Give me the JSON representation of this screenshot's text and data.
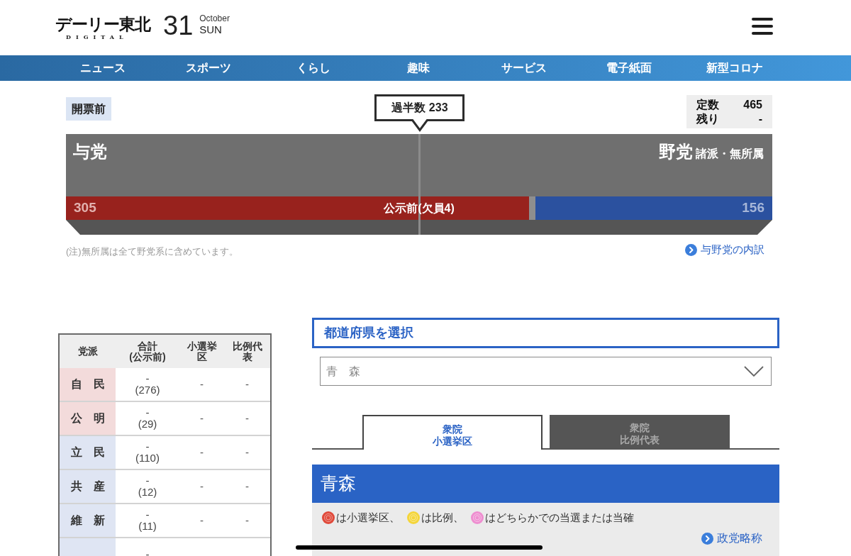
{
  "header": {
    "logo": "デーリー東北",
    "logo_subtitle": "DIGITAL",
    "day": "31",
    "month": "October",
    "weekday": "SUN"
  },
  "nav": [
    "ニュース",
    "スポーツ",
    "くらし",
    "趣味",
    "サービス",
    "電子紙面",
    "新型コロナ"
  ],
  "seat_summary": {
    "status": "開票前",
    "majority": {
      "label": "過半数 233",
      "level": 0.501
    },
    "totals": [
      {
        "label": "定数",
        "value": "465"
      },
      {
        "label": "残り",
        "value": "-"
      }
    ],
    "ruling": {
      "label": "与党",
      "seats": "305",
      "level": 0.656
    },
    "opposition": {
      "label": "野党",
      "sublabel": "諸派・無所属",
      "seats": "156",
      "level": 0.335
    },
    "vacancy_label": "公示前(欠員4)",
    "note": "(注)無所属は全て野党系に含めています。",
    "link": "与野党の内訳"
  },
  "party_table": {
    "columns": [
      {
        "lines": [
          "党派"
        ]
      },
      {
        "lines": [
          "合計",
          "(公示前)"
        ]
      },
      {
        "lines": [
          "小選挙区"
        ]
      },
      {
        "lines": [
          "比例代表"
        ]
      }
    ],
    "rows": [
      {
        "party": "自　民",
        "color": "#f3dbdb",
        "total": "-",
        "pre_election": "(276)",
        "district": "-",
        "proportional": "-"
      },
      {
        "party": "公　明",
        "color": "#f3dbdb",
        "total": "-",
        "pre_election": "(29)",
        "district": "-",
        "proportional": "-"
      },
      {
        "party": "立　民",
        "color": "#dfe5f3",
        "total": "-",
        "pre_election": "(110)",
        "district": "-",
        "proportional": "-"
      },
      {
        "party": "共　産",
        "color": "#dfe5f3",
        "total": "-",
        "pre_election": "(12)",
        "district": "-",
        "proportional": "-"
      },
      {
        "party": "維　新",
        "color": "#dfe5f3",
        "total": "-",
        "pre_election": "(11)",
        "district": "-",
        "proportional": "-"
      },
      {
        "color": "#dfe5f3",
        "total": "-"
      }
    ]
  },
  "prefecture": {
    "heading": "都道府県を選択",
    "value": "青　森"
  },
  "tabs": [
    {
      "lines": [
        "衆院",
        "小選挙区"
      ],
      "selected": true
    },
    {
      "lines": [
        "衆院",
        "比例代表"
      ],
      "selected": false
    }
  ],
  "results": {
    "title": "青森",
    "legend": [
      {
        "color": "#e04a3b",
        "text": "は小選挙区、"
      },
      {
        "color": "#f4d53a",
        "text": "は比例、"
      },
      {
        "color": "#ee8ed0",
        "text": "はどちらかでの当選または当確"
      }
    ],
    "link": "政党略称"
  }
}
